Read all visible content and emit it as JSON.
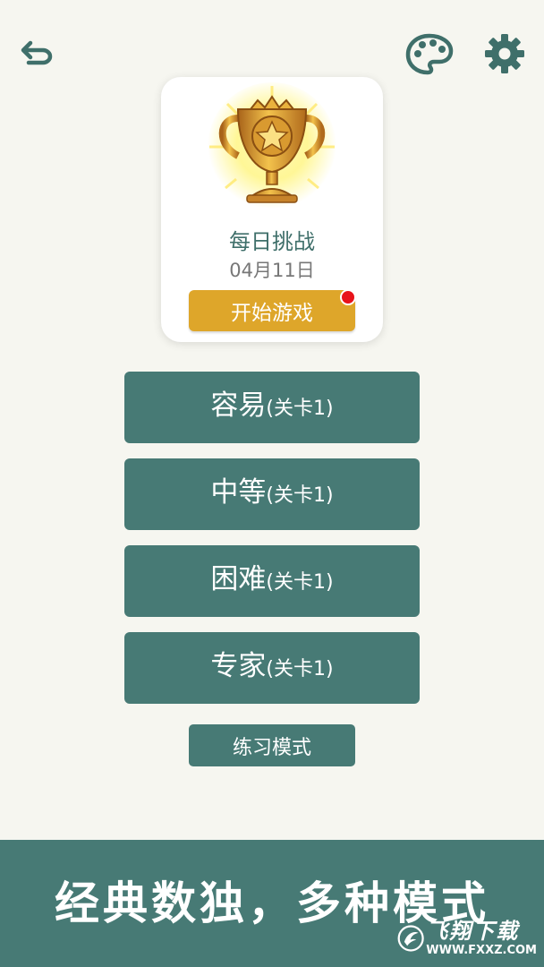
{
  "header": {
    "back_icon": "back-arrow-icon",
    "palette_icon": "palette-icon",
    "settings_icon": "gear-icon"
  },
  "daily_challenge": {
    "icon": "trophy-icon",
    "title": "每日挑战",
    "date": "04月11日",
    "start_label": "开始游戏",
    "notification_dot": true
  },
  "levels": [
    {
      "name": "容易",
      "sub": "(关卡1)"
    },
    {
      "name": "中等",
      "sub": "(关卡1)"
    },
    {
      "name": "困难",
      "sub": "(关卡1)"
    },
    {
      "name": "专家",
      "sub": "(关卡1)"
    }
  ],
  "practice_label": "练习模式",
  "banner": {
    "text": "经典数独，多种模式"
  },
  "watermark": {
    "title": "飞翔下载",
    "url": "WWW.FXXZ.COM"
  },
  "colors": {
    "primary": "#477a75",
    "accent": "#dea62a",
    "background": "#f6f6f0",
    "notification": "#e8131a"
  }
}
